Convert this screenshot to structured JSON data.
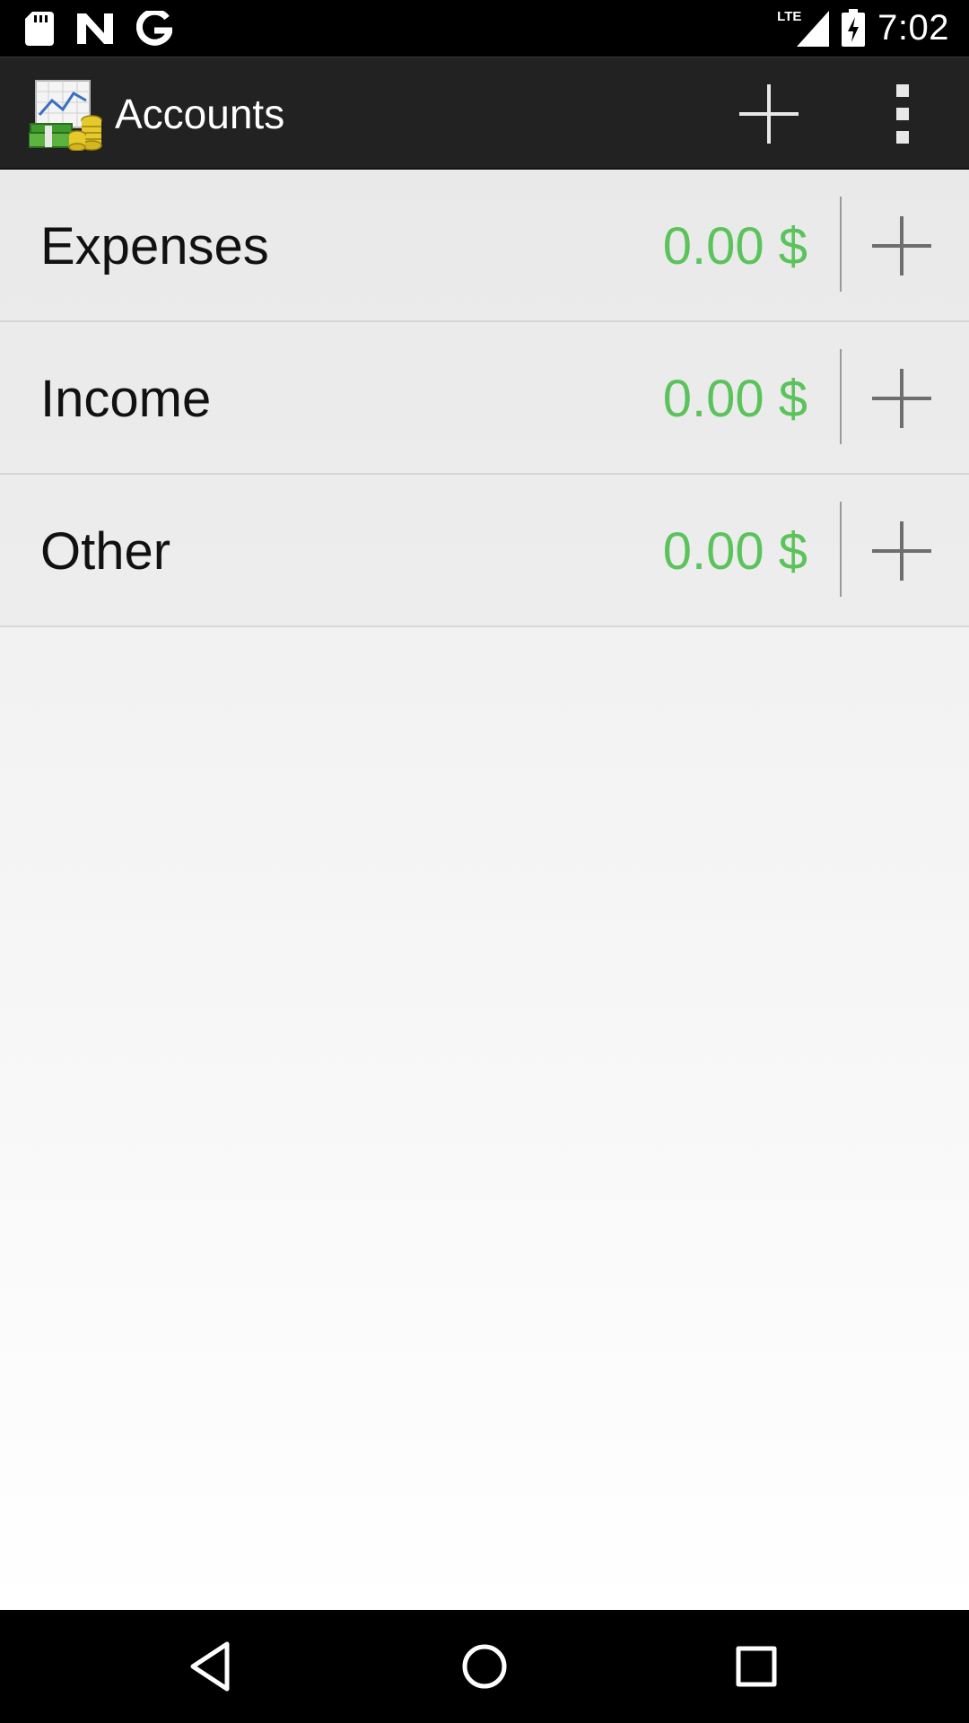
{
  "status_bar": {
    "time": "7:02",
    "network": "LTE",
    "left_icons": [
      "sd-card-icon",
      "n-notification-icon",
      "google-icon"
    ]
  },
  "action_bar": {
    "title": "Accounts",
    "add_icon": "plus-icon",
    "overflow_icon": "overflow-menu-icon"
  },
  "accounts": [
    {
      "name": "Expenses",
      "balance": "0.00 $"
    },
    {
      "name": "Income",
      "balance": "0.00 $"
    },
    {
      "name": "Other",
      "balance": "0.00 $"
    }
  ],
  "colors": {
    "balance": "#5cc35c",
    "action_bar": "#222222"
  },
  "nav_bar": {
    "icons": [
      "back-icon",
      "home-icon",
      "recents-icon"
    ]
  }
}
